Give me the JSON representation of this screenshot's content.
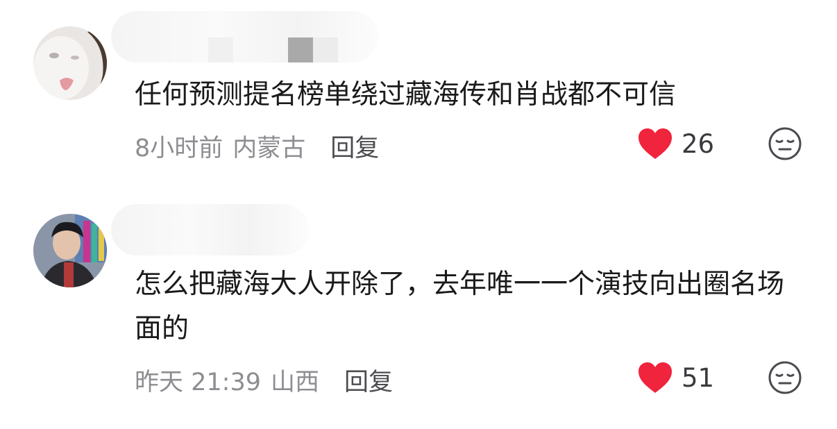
{
  "comments": [
    {
      "text": "任何预测提名榜单绕过藏海传和肖战都不可信",
      "time": "8小时前",
      "location": "内蒙古",
      "reply_label": "回复",
      "likes": "26"
    },
    {
      "text": "怎么把藏海大人开除了，去年唯一一个演技向出圈名场面的",
      "time": "昨天 21:39",
      "location": "山西",
      "reply_label": "回复",
      "likes": "51"
    }
  ],
  "icons": {
    "like": "heart-icon",
    "dislike": "unamused-face-icon"
  },
  "colors": {
    "heart": "#f0243d",
    "meta_text": "#8d8d92",
    "body_text": "#1a1a1a"
  }
}
